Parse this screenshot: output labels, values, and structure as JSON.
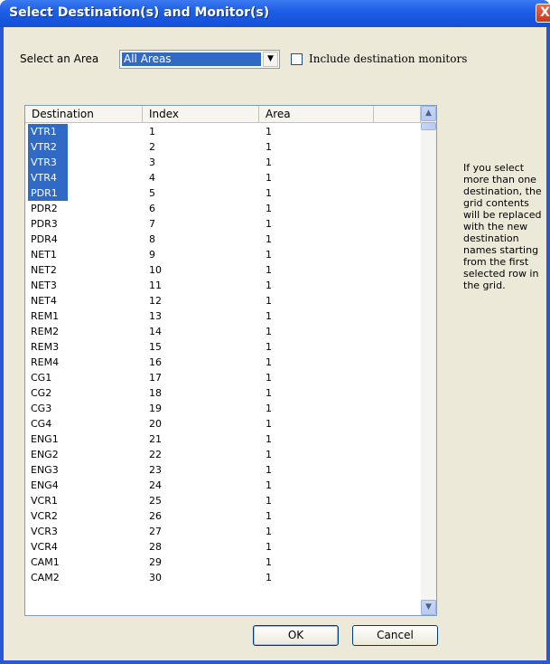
{
  "window": {
    "title": "Select Destination(s) and Monitor(s)"
  },
  "title_bar": {
    "close_glyph": "X"
  },
  "area": {
    "label": "Select an Area",
    "selected": "All Areas",
    "include_monitors_label": "Include destination monitors",
    "include_monitors_checked": false
  },
  "grid": {
    "columns": [
      "Destination",
      "Index",
      "Area"
    ],
    "rows": [
      {
        "destination": "VTR1",
        "index": "1",
        "area": "1",
        "selected": true
      },
      {
        "destination": "VTR2",
        "index": "2",
        "area": "1",
        "selected": true
      },
      {
        "destination": "VTR3",
        "index": "3",
        "area": "1",
        "selected": true
      },
      {
        "destination": "VTR4",
        "index": "4",
        "area": "1",
        "selected": true
      },
      {
        "destination": "PDR1",
        "index": "5",
        "area": "1",
        "selected": true
      },
      {
        "destination": "PDR2",
        "index": "6",
        "area": "1",
        "selected": false
      },
      {
        "destination": "PDR3",
        "index": "7",
        "area": "1",
        "selected": false
      },
      {
        "destination": "PDR4",
        "index": "8",
        "area": "1",
        "selected": false
      },
      {
        "destination": "NET1",
        "index": "9",
        "area": "1",
        "selected": false
      },
      {
        "destination": "NET2",
        "index": "10",
        "area": "1",
        "selected": false
      },
      {
        "destination": "NET3",
        "index": "11",
        "area": "1",
        "selected": false
      },
      {
        "destination": "NET4",
        "index": "12",
        "area": "1",
        "selected": false
      },
      {
        "destination": "REM1",
        "index": "13",
        "area": "1",
        "selected": false
      },
      {
        "destination": "REM2",
        "index": "14",
        "area": "1",
        "selected": false
      },
      {
        "destination": "REM3",
        "index": "15",
        "area": "1",
        "selected": false
      },
      {
        "destination": "REM4",
        "index": "16",
        "area": "1",
        "selected": false
      },
      {
        "destination": "CG1",
        "index": "17",
        "area": "1",
        "selected": false
      },
      {
        "destination": "CG2",
        "index": "18",
        "area": "1",
        "selected": false
      },
      {
        "destination": "CG3",
        "index": "19",
        "area": "1",
        "selected": false
      },
      {
        "destination": "CG4",
        "index": "20",
        "area": "1",
        "selected": false
      },
      {
        "destination": "ENG1",
        "index": "21",
        "area": "1",
        "selected": false
      },
      {
        "destination": "ENG2",
        "index": "22",
        "area": "1",
        "selected": false
      },
      {
        "destination": "ENG3",
        "index": "23",
        "area": "1",
        "selected": false
      },
      {
        "destination": "ENG4",
        "index": "24",
        "area": "1",
        "selected": false
      },
      {
        "destination": "VCR1",
        "index": "25",
        "area": "1",
        "selected": false
      },
      {
        "destination": "VCR2",
        "index": "26",
        "area": "1",
        "selected": false
      },
      {
        "destination": "VCR3",
        "index": "27",
        "area": "1",
        "selected": false
      },
      {
        "destination": "VCR4",
        "index": "28",
        "area": "1",
        "selected": false
      },
      {
        "destination": "CAM1",
        "index": "29",
        "area": "1",
        "selected": false
      },
      {
        "destination": "CAM2",
        "index": "30",
        "area": "1",
        "selected": false
      }
    ]
  },
  "info": "If you select more than one destination, the grid contents will be replaced with the new destination names starting from the first selected row in the grid.",
  "buttons": {
    "ok": "OK",
    "cancel": "Cancel"
  },
  "colors": {
    "title_bar": "#1f5ee6",
    "dialog_bg": "#ece9d8",
    "selection": "#316ac5"
  },
  "icons": {
    "dropdown": "chevron-down-icon",
    "scroll_up": "scroll-up-icon",
    "scroll_down": "scroll-down-icon"
  }
}
